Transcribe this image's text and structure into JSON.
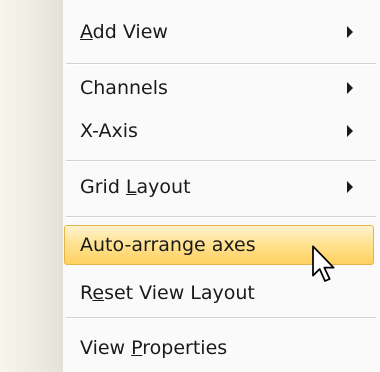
{
  "menu": {
    "items": [
      {
        "label": "Add View",
        "mnemonic": "A",
        "rest": "dd View",
        "has_submenu": true
      },
      {
        "label": "Channels",
        "has_submenu": true
      },
      {
        "label": "X-Axis",
        "has_submenu": true
      },
      {
        "label": "Grid Layout",
        "pre": "Grid ",
        "mnemonic": "L",
        "rest": "ayout",
        "has_submenu": true
      },
      {
        "label": "Auto-arrange axes",
        "highlighted": true
      },
      {
        "label": "Reset View Layout",
        "pre": "R",
        "mnemonic": "e",
        "rest": "set View Layout"
      },
      {
        "label": "View Properties",
        "pre": "View ",
        "mnemonic": "P",
        "rest": "roperties"
      }
    ]
  },
  "colors": {
    "highlight_top": "#fff4cf",
    "highlight_bottom": "#ffd160",
    "highlight_border": "#e6b44a",
    "gutter": "#eeebe2",
    "text": "#1a1a1a"
  },
  "icons": {
    "submenu": "chevron-right-icon",
    "cursor": "mouse-pointer-icon"
  }
}
